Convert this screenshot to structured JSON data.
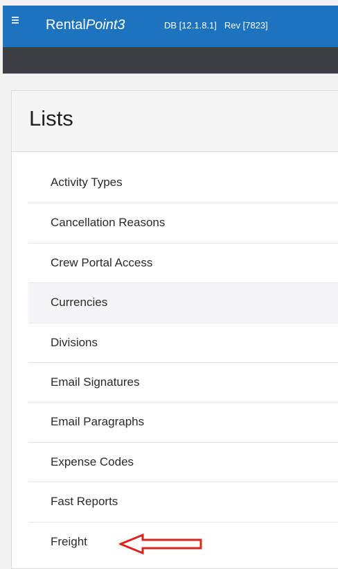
{
  "header": {
    "menu_icon": "hamburger-icon",
    "brand_prefix": "Rental",
    "brand_italic": "Point3",
    "db_version": "DB [12.1.8.1]",
    "revision": "Rev [7823]",
    "accent_color": "#1e73be",
    "subbar_color": "#3d3f45"
  },
  "panel": {
    "title": "Lists"
  },
  "list": {
    "items": [
      {
        "label": "Activity Types"
      },
      {
        "label": "Cancellation Reasons"
      },
      {
        "label": "Crew Portal Access"
      },
      {
        "label": "Currencies"
      },
      {
        "label": "Divisions"
      },
      {
        "label": "Email Signatures"
      },
      {
        "label": "Email Paragraphs"
      },
      {
        "label": "Expense Codes"
      },
      {
        "label": "Fast Reports"
      },
      {
        "label": "Freight"
      }
    ],
    "hovered_item": "Currencies"
  },
  "annotation": {
    "icon": "arrow-left-icon",
    "target_item": "Freight",
    "color": "#d9241c"
  }
}
